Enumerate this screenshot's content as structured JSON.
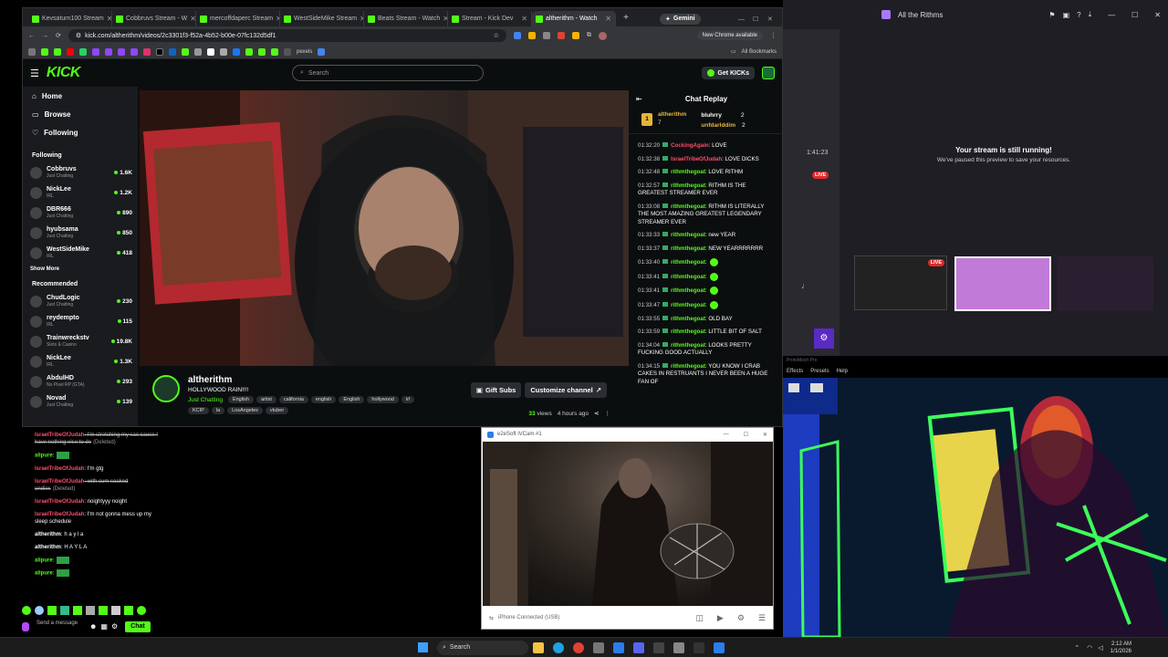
{
  "browser": {
    "tabs": [
      {
        "label": "Kevsaturn100 Stream"
      },
      {
        "label": "Cobbruvs Stream - W"
      },
      {
        "label": "mercoffdaperc Stream"
      },
      {
        "label": "WestSideMike Stream"
      },
      {
        "label": "Beats Stream - Watch"
      },
      {
        "label": "Stream - Kick Dev"
      },
      {
        "label": "altherithm - Watch"
      }
    ],
    "gemini_label": "Gemini",
    "url": "kick.com/altherithm/videos/2c3301f3-f52a-4b52-b00e-07fc132d5df1",
    "new_chrome": "New Chrome available",
    "all_bookmarks": "All Bookmarks",
    "pexels": "pexels"
  },
  "kick": {
    "logo": "KICK",
    "search_placeholder": "Search",
    "get_kicks": "Get KICKs",
    "nav": [
      {
        "label": "Home",
        "icon": "home-icon"
      },
      {
        "label": "Browse",
        "icon": "browse-icon"
      },
      {
        "label": "Following",
        "icon": "heart-icon"
      }
    ],
    "following_title": "Following",
    "following": [
      {
        "name": "Cobbruvs",
        "sub": "Just Chatting",
        "viewers": "1.6K"
      },
      {
        "name": "NickLee",
        "sub": "IRL",
        "viewers": "1.2K"
      },
      {
        "name": "DBR666",
        "sub": "Just Chatting",
        "viewers": "890"
      },
      {
        "name": "hyubsama",
        "sub": "Just Chatting",
        "viewers": "850"
      },
      {
        "name": "WestSideMike",
        "sub": "IRL",
        "viewers": "418"
      }
    ],
    "show_more": "Show More",
    "recommended_title": "Recommended",
    "recommended": [
      {
        "name": "ChudLogic",
        "sub": "Just Chatting",
        "viewers": "230"
      },
      {
        "name": "reydempto",
        "sub": "IRL",
        "viewers": "115"
      },
      {
        "name": "Trainwreckstv",
        "sub": "Slots & Casino",
        "viewers": "19.8K"
      },
      {
        "name": "NickLee",
        "sub": "IRL",
        "viewers": "1.3K"
      },
      {
        "name": "AbdulHD",
        "sub": "No Pixel RP (GTA)",
        "viewers": "293"
      },
      {
        "name": "Novad",
        "sub": "Just Chatting",
        "viewers": "139"
      }
    ],
    "stream": {
      "channel": "altherithm",
      "title": "HOLLYWOOD RAIN!!!!",
      "category": "Just Chatting",
      "tags_row1": [
        "English",
        "artist",
        "california",
        "english",
        "English",
        "hollywood",
        "irl"
      ],
      "tags_row2": [
        "KCIP",
        "la",
        "LosAngeles",
        "vtuber"
      ],
      "views_count": "33",
      "views_label": "views",
      "age": "4 hours ago",
      "gift_subs": "Gift Subs",
      "customize": "Customize channel"
    },
    "chat_title": "Chat Replay",
    "leaderboard": [
      {
        "name": "altherithm",
        "value": "7"
      },
      {
        "name": "bluhrry",
        "value": "2"
      },
      {
        "name": "unfdarlddim",
        "value": "2"
      }
    ],
    "chat": [
      {
        "t": "01:32:20",
        "u": "CockingAgain",
        "c": "#ff4d6d",
        "m": ": LOVE"
      },
      {
        "t": "01:32:38",
        "u": "IsraelTribeOfJudah",
        "c": "#ff4d6d",
        "m": ": LOVE DICKS"
      },
      {
        "t": "01:32:48",
        "u": "rithmthegoat",
        "c": "#53fc18",
        "m": ": LOVE RITHM"
      },
      {
        "t": "01:32:57",
        "u": "rithmthegoat",
        "c": "#53fc18",
        "m": ": RITHM IS THE GREATEST STREAMER EVER"
      },
      {
        "t": "01:33:08",
        "u": "rithmthegoat",
        "c": "#53fc18",
        "m": ": RITHM IS LITERALLY THE MOST AMAZING GREATEST LEGENDARY STREAMER EVER"
      },
      {
        "t": "01:33:33",
        "u": "rithmthegoat",
        "c": "#53fc18",
        "m": ": new YEAR"
      },
      {
        "t": "01:33:37",
        "u": "rithmthegoat",
        "c": "#53fc18",
        "m": ": NEW YEARRRRRRR"
      },
      {
        "t": "01:33:40",
        "u": "rithmthegoat",
        "c": "#53fc18",
        "m": ":"
      },
      {
        "t": "01:33:41",
        "u": "rithmthegoat",
        "c": "#53fc18",
        "m": ":"
      },
      {
        "t": "01:33:41",
        "u": "rithmthegoat",
        "c": "#53fc18",
        "m": ":"
      },
      {
        "t": "01:33:47",
        "u": "rithmthegoat",
        "c": "#53fc18",
        "m": ":"
      },
      {
        "t": "01:33:55",
        "u": "rithmthegoat",
        "c": "#53fc18",
        "m": ": OLD BAY"
      },
      {
        "t": "01:33:59",
        "u": "rithmthegoat",
        "c": "#53fc18",
        "m": ": LITTLE BIT OF SALT"
      },
      {
        "t": "01:34:04",
        "u": "rithmthegoat",
        "c": "#53fc18",
        "m": ": LOOKS PRETTY FUCKING GOOD ACTUALLY"
      },
      {
        "t": "01:34:15",
        "u": "rithmthegoat",
        "c": "#53fc18",
        "m": ": YOU KNOW I CRAB CAKES IN RESTRUANTS I NEVER BEEN A HUGE FAN OF"
      }
    ]
  },
  "left_chat": {
    "messages": [
      {
        "u": "IsraelTribeOfJudah",
        "c": "#ff4d6d",
        "m": ": I'm stretching my sac cause I have nothing else to do",
        "deleted": "(Deleted)"
      },
      {
        "u": "alipure",
        "c": "#53fc18",
        "m": ":",
        "deleted": ""
      },
      {
        "u": "IsraelTribeOfJudah",
        "c": "#ff4d6d",
        "m": ": I'm gtg",
        "deleted": ""
      },
      {
        "u": "IsraelTribeOfJudah",
        "c": "#ff4d6d",
        "m": ": with cum soaked undies",
        "deleted": "(Deleted)"
      },
      {
        "u": "IsraelTribeOfJudah",
        "c": "#ff4d6d",
        "m": ": noightyyy noight",
        "deleted": ""
      },
      {
        "u": "IsraelTribeOfJudah",
        "c": "#ff4d6d",
        "m": ": I'm not gonna mess up my sleep schedule",
        "deleted": ""
      },
      {
        "u": "altherithm",
        "c": "#ffffff",
        "m": ": h a y l a",
        "deleted": ""
      },
      {
        "u": "altherithm",
        "c": "#ffffff",
        "m": ": H A Y L A",
        "deleted": ""
      },
      {
        "u": "alipure",
        "c": "#53fc18",
        "m": ":",
        "deleted": ""
      },
      {
        "u": "alipure",
        "c": "#53fc18",
        "m": ":",
        "deleted": ""
      }
    ],
    "send_placeholder": "Send a message",
    "chat_button": "Chat"
  },
  "webcam": {
    "title": "e2eSoft iVCam #1",
    "status": "iPhone Connected (USB)"
  },
  "obs": {
    "title": "All the Rithms",
    "running_title": "Your stream is still running!",
    "running_sub": "We've paused this preview to save your resources.",
    "timer": "1:41:23",
    "live_badge": "LIVE",
    "live_badge2": "LIVE",
    "menu": [
      "Effects",
      "Presets",
      "Help"
    ],
    "app_label": "ProtoMoch Pro"
  },
  "taskbar": {
    "search": "Search",
    "time": "2:12 AM",
    "date": "1/1/2026"
  },
  "colors": {
    "kick_green": "#53fc18",
    "accent_red": "#ff4d6d"
  }
}
